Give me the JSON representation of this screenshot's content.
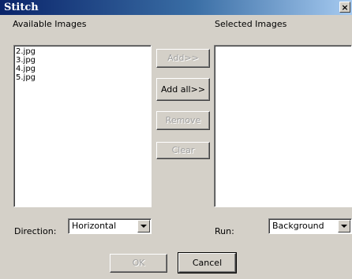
{
  "window": {
    "title": "Stitch",
    "close_label": "×"
  },
  "available": {
    "label": "Available Images",
    "items": [
      "2.jpg",
      "3.jpg",
      "4.jpg",
      "5.jpg"
    ]
  },
  "selected": {
    "label": "Selected Images",
    "items": []
  },
  "buttons": {
    "add": "Add>>",
    "add_all": "Add all>>",
    "remove": "Remove",
    "clear": "Clear",
    "ok": "OK",
    "cancel": "Cancel"
  },
  "direction": {
    "label": "Direction:",
    "value": "Horizontal"
  },
  "run": {
    "label": "Run:",
    "value": "Background"
  }
}
